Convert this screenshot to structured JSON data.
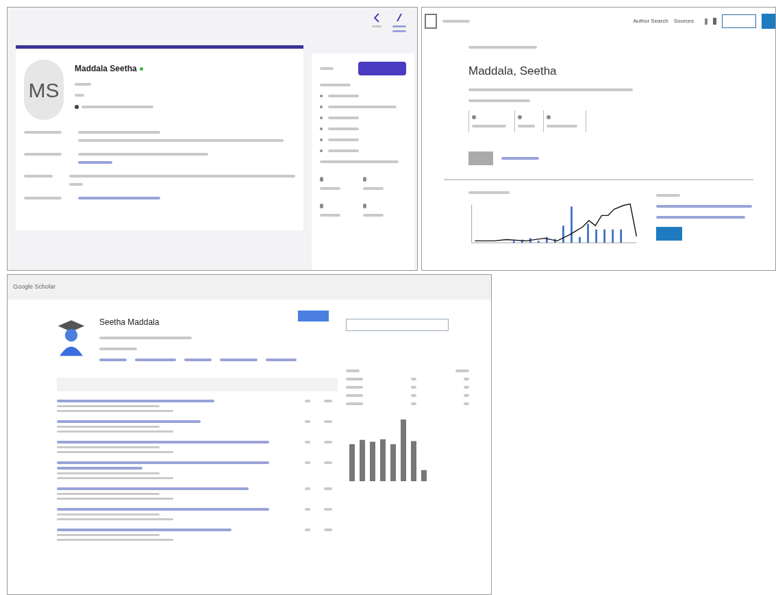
{
  "scopus_profile": {
    "initials": "MS",
    "name": "Maddala Seetha"
  },
  "publons_profile": {
    "nav": [
      "Author Search",
      "Sources"
    ],
    "name": "Maddala, Seetha"
  },
  "scholar_profile": {
    "brand": "Google Scholar",
    "name": "Seetha Maddala"
  }
}
